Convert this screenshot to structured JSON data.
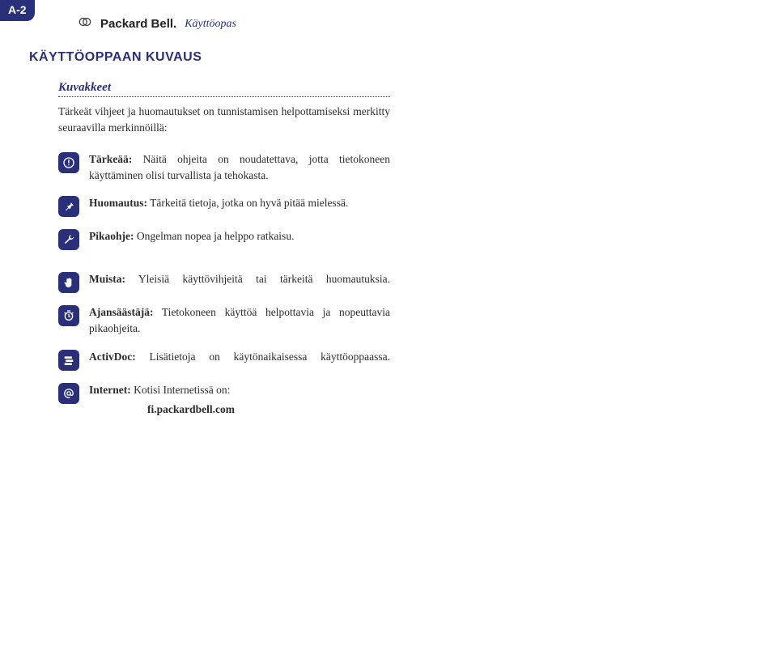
{
  "page_tab": "A-2",
  "brand": "Packard Bell.",
  "guide": "Käyttöopas",
  "section_title": "KÄYTTÖOPPAAN KUVAUS",
  "subhead": "Kuvakkeet",
  "intro": "Tärkeät vihjeet ja huomautukset on tunnistamisen helpottamiseksi merkitty seuraavilla merkinnöillä:",
  "items": {
    "important": {
      "lead": "Tärkeää:",
      "text": " Näitä ohjeita on noudatettava, jotta tietokoneen käyttäminen olisi turvallista ja tehokasta."
    },
    "note": {
      "lead": "Huomautus:",
      "text": " Tärkeitä tietoja, jotka on hyvä pitää mielessä."
    },
    "quick": {
      "lead": "Pikaohje:",
      "text": " Ongelman nopea ja helppo ratkaisu."
    },
    "remember": {
      "lead": "Muista:",
      "text": " Yleisiä käyttövihjeitä tai tärkeitä huomautuksia."
    },
    "timesaver": {
      "lead": "Ajansäästäjä:",
      "text": " Tietokoneen käyttöä helpottavia ja nopeuttavia pikaohjeita."
    },
    "activdoc": {
      "lead": "ActivDoc:",
      "text": " Lisätietoja on käytönaikaisessa käyttöoppaassa."
    },
    "internet": {
      "lead": "Internet:",
      "text": " Kotisi Internetissä on:",
      "url": "fi.packardbell.com"
    }
  }
}
